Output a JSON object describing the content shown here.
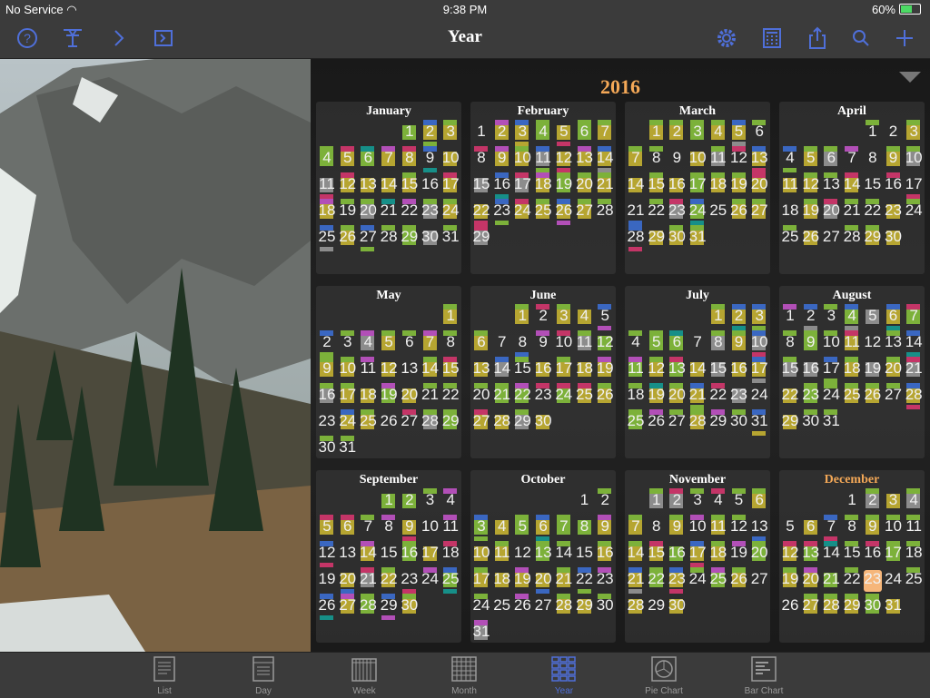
{
  "status": {
    "carrier": "No Service",
    "time": "9:38 PM",
    "battery": "60%"
  },
  "nav": {
    "title": "Year"
  },
  "calendar": {
    "year": "2016",
    "current_month_index": 11,
    "today": {
      "month": 11,
      "day": 23
    },
    "months": [
      {
        "name": "January",
        "start": 4,
        "days": 31
      },
      {
        "name": "February",
        "start": 0,
        "days": 29
      },
      {
        "name": "March",
        "start": 1,
        "days": 31
      },
      {
        "name": "April",
        "start": 4,
        "days": 30
      },
      {
        "name": "May",
        "start": 6,
        "days": 31
      },
      {
        "name": "June",
        "start": 2,
        "days": 30
      },
      {
        "name": "July",
        "start": 4,
        "days": 31
      },
      {
        "name": "August",
        "start": 0,
        "days": 31
      },
      {
        "name": "September",
        "start": 3,
        "days": 30
      },
      {
        "name": "October",
        "start": 5,
        "days": 31
      },
      {
        "name": "November",
        "start": 1,
        "days": 30
      },
      {
        "name": "December",
        "start": 3,
        "days": 31
      }
    ]
  },
  "tabs": [
    {
      "label": "List",
      "icon": "list-icon"
    },
    {
      "label": "Day",
      "icon": "day-icon"
    },
    {
      "label": "Week",
      "icon": "week-icon"
    },
    {
      "label": "Month",
      "icon": "month-icon"
    },
    {
      "label": "Year",
      "icon": "year-icon"
    },
    {
      "label": "Pie Chart",
      "icon": "pie-chart-icon"
    },
    {
      "label": "Bar Chart",
      "icon": "bar-chart-icon"
    }
  ],
  "colors": {
    "accent": "#4f6fd9",
    "year_title": "#f4a857",
    "today_highlight": "#f6b67a",
    "event_green": "#7cb13a",
    "event_olive": "#b6a531",
    "event_gray": "#8c8c8c",
    "event_teal": "#168f88",
    "event_magenta": "#b24fb7",
    "event_pink": "#c43567",
    "event_blue": "#3a67c1"
  }
}
